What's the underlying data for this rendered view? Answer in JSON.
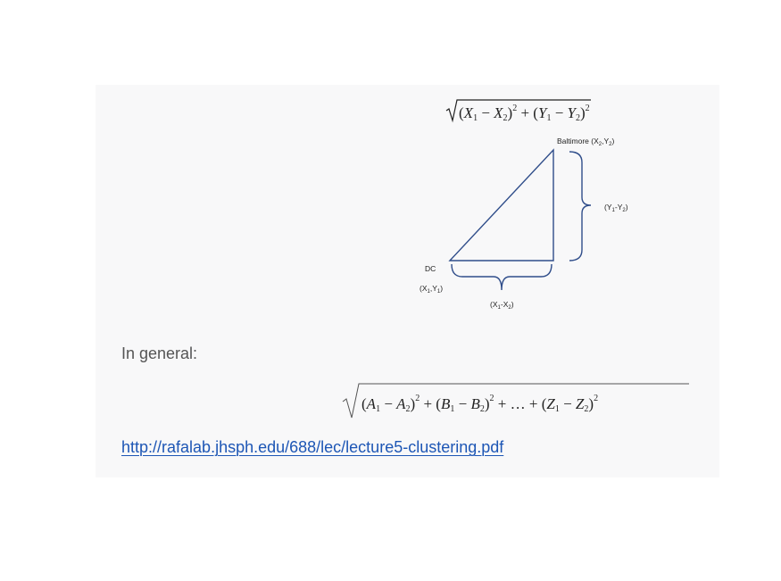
{
  "diagram": {
    "top_formula": {
      "x1": "X",
      "x1_sub": "1",
      "x2": "X",
      "x2_sub": "2",
      "y1": "Y",
      "y1_sub": "1",
      "y2": "Y",
      "y2_sub": "2",
      "exponent": "2"
    },
    "baltimore": {
      "name": "Baltimore",
      "x": "X",
      "x_sub": "2",
      "y": "Y",
      "y_sub": "2"
    },
    "dc": {
      "name": "DC",
      "x": "X",
      "x_sub": "1",
      "y": "Y",
      "y_sub": "1"
    },
    "vertical_diff": {
      "a": "Y",
      "a_sub": "1",
      "b": "Y",
      "b_sub": "2"
    },
    "horizontal_diff": {
      "a": "X",
      "a_sub": "1",
      "b": "X",
      "b_sub": "2"
    }
  },
  "general": {
    "label": "In general:",
    "formula": {
      "a1": "A",
      "a1_sub": "1",
      "a2": "A",
      "a2_sub": "2",
      "b1": "B",
      "b1_sub": "1",
      "b2": "B",
      "b2_sub": "2",
      "z1": "Z",
      "z1_sub": "1",
      "z2": "Z",
      "z2_sub": "2",
      "exponent": "2",
      "ellipsis": "…"
    }
  },
  "source": {
    "url": "http://rafalab.jhsph.edu/688/lec/lecture5-clustering.pdf"
  }
}
